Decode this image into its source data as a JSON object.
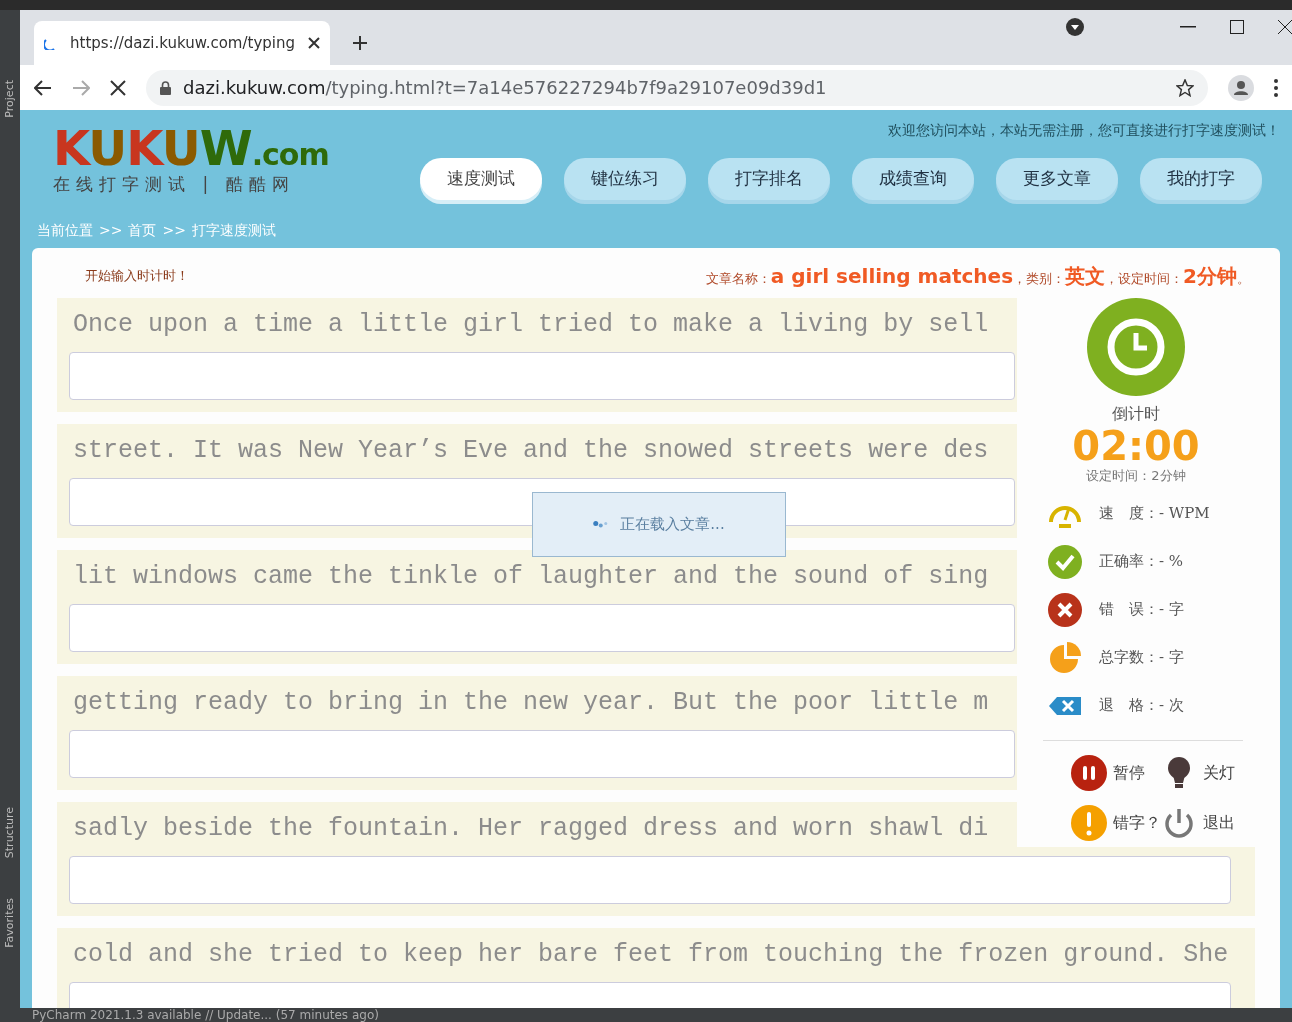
{
  "ide": {
    "sidebar_tabs": [
      "Project",
      "Structure",
      "Favorites"
    ],
    "status_bar": "PyCharm 2021.1.3 available // Update... (57 minutes ago)"
  },
  "browser": {
    "tab_title": "https://dazi.kukuw.com/typing",
    "url_domain": "dazi.kukuw.com",
    "url_path": "/typing.html?t=7a14e576227294b7f9a29107e09d39d1",
    "loading": true
  },
  "site": {
    "logo": {
      "wordmark": "KUKUW",
      "suffix": ".com",
      "tagline": "在线打字测试 | 酷酷网"
    },
    "welcome": "欢迎您访问本站，本站无需注册，您可直接进行打字速度测试！",
    "nav": [
      {
        "label": "速度测试",
        "selected": true
      },
      {
        "label": "键位练习",
        "selected": false
      },
      {
        "label": "打字排名",
        "selected": false
      },
      {
        "label": "成绩查询",
        "selected": false
      },
      {
        "label": "更多文章",
        "selected": false
      },
      {
        "label": "我的打字",
        "selected": false
      }
    ],
    "breadcrumb": [
      "当前位置",
      ">>",
      "首页",
      ">>",
      "打字速度测试"
    ]
  },
  "typing": {
    "hint": "开始输入时计时！",
    "article": [
      {
        "label": "文章名称：",
        "value": "a girl selling matches"
      },
      {
        "label": "，类别：",
        "value": "英文"
      },
      {
        "label": "，设定时间：",
        "value": "2分钟"
      }
    ],
    "article_end": "。",
    "lines": [
      "Once upon a time a little girl tried to make a living by sell",
      "street. It was New Year’s Eve and the snowed streets were des",
      "lit windows came the tinkle of laughter and the sound of sing",
      "getting ready to bring in the new year. But the poor little m",
      "sadly beside the fountain. Her ragged dress and worn shawl di",
      "cold and she tried to keep her bare feet from touching the frozen ground. She"
    ],
    "loading_message": "正在载入文章..."
  },
  "panel": {
    "timer_label": "倒计时",
    "timer_value": "02:00",
    "timer_setting": "设定时间：2分钟",
    "stats": [
      {
        "kind": "speed",
        "text": "速　度：- WPM"
      },
      {
        "kind": "accuracy",
        "text": "正确率：- %"
      },
      {
        "kind": "errors",
        "text": "错　误：- 字"
      },
      {
        "kind": "total",
        "text": "总字数：- 字"
      },
      {
        "kind": "backspace",
        "text": "退　格：- 次"
      }
    ],
    "actions": [
      {
        "kind": "pause",
        "label": "暂停"
      },
      {
        "kind": "light",
        "label": "关灯"
      },
      {
        "kind": "report",
        "label": "错字？"
      },
      {
        "kind": "exit",
        "label": "退出"
      }
    ]
  }
}
